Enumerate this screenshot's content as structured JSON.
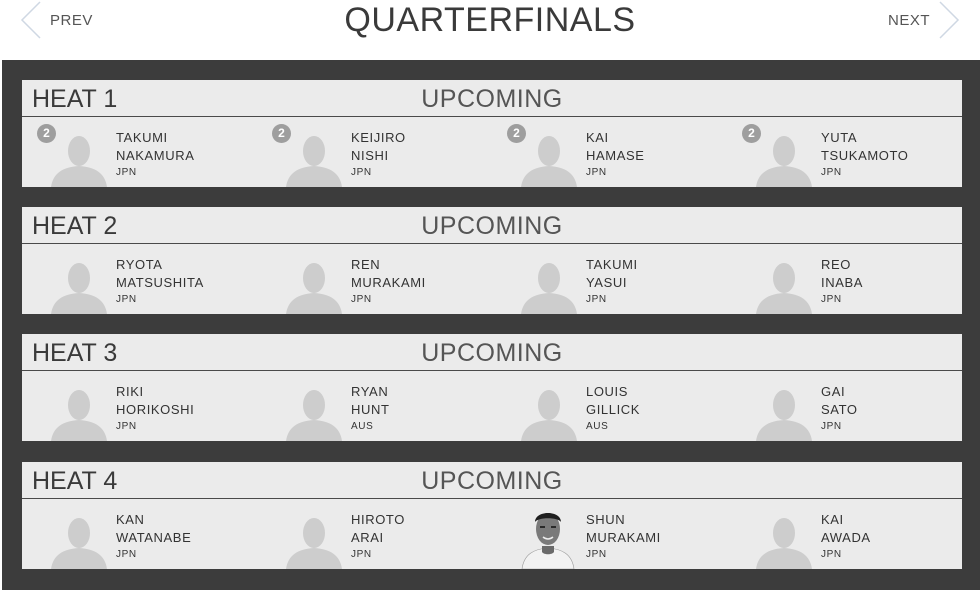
{
  "nav": {
    "prev_label": "PREV",
    "next_label": "NEXT"
  },
  "round": {
    "title": "QUARTERFINALS"
  },
  "heats": [
    {
      "title": "HEAT 1",
      "status": "UPCOMING",
      "athletes": [
        {
          "seed": "2",
          "first": "TAKUMI",
          "last": "NAKAMURA",
          "country": "JPN",
          "photo": "placeholder-silhouette"
        },
        {
          "seed": "2",
          "first": "KEIJIRO",
          "last": "NISHI",
          "country": "JPN",
          "photo": "placeholder-silhouette"
        },
        {
          "seed": "2",
          "first": "KAI",
          "last": "HAMASE",
          "country": "JPN",
          "photo": "placeholder-silhouette"
        },
        {
          "seed": "2",
          "first": "YUTA",
          "last": "TSUKAMOTO",
          "country": "JPN",
          "photo": "placeholder-silhouette"
        }
      ]
    },
    {
      "title": "HEAT 2",
      "status": "UPCOMING",
      "athletes": [
        {
          "first": "RYOTA",
          "last": "MATSUSHITA",
          "country": "JPN",
          "photo": "placeholder-silhouette"
        },
        {
          "first": "REN",
          "last": "MURAKAMI",
          "country": "JPN",
          "photo": "placeholder-silhouette"
        },
        {
          "first": "TAKUMI",
          "last": "YASUI",
          "country": "JPN",
          "photo": "placeholder-silhouette"
        },
        {
          "first": "REO",
          "last": "INABA",
          "country": "JPN",
          "photo": "placeholder-silhouette"
        }
      ]
    },
    {
      "title": "HEAT 3",
      "status": "UPCOMING",
      "athletes": [
        {
          "first": "RIKI",
          "last": "HORIKOSHI",
          "country": "JPN",
          "photo": "placeholder-silhouette"
        },
        {
          "first": "RYAN",
          "last": "HUNT",
          "country": "AUS",
          "photo": "placeholder-silhouette"
        },
        {
          "first": "LOUIS",
          "last": "GILLICK",
          "country": "AUS",
          "photo": "placeholder-silhouette"
        },
        {
          "first": "GAI",
          "last": "SATO",
          "country": "JPN",
          "photo": "placeholder-silhouette"
        }
      ]
    },
    {
      "title": "HEAT 4",
      "status": "UPCOMING",
      "athletes": [
        {
          "first": "KAN",
          "last": "WATANABE",
          "country": "JPN",
          "photo": "placeholder-silhouette"
        },
        {
          "first": "HIROTO",
          "last": "ARAI",
          "country": "JPN",
          "photo": "placeholder-silhouette"
        },
        {
          "first": "SHUN",
          "last": "MURAKAMI",
          "country": "JPN",
          "photo": "headshot"
        },
        {
          "first": "KAI",
          "last": "AWADA",
          "country": "JPN",
          "photo": "placeholder-silhouette"
        }
      ]
    }
  ],
  "colors": {
    "accent": "#1565c0",
    "background_dark": "#3c3c3c",
    "card": "#ebebeb",
    "seed_badge": "#9e9e9e",
    "silhouette": "#cdcdcd"
  }
}
